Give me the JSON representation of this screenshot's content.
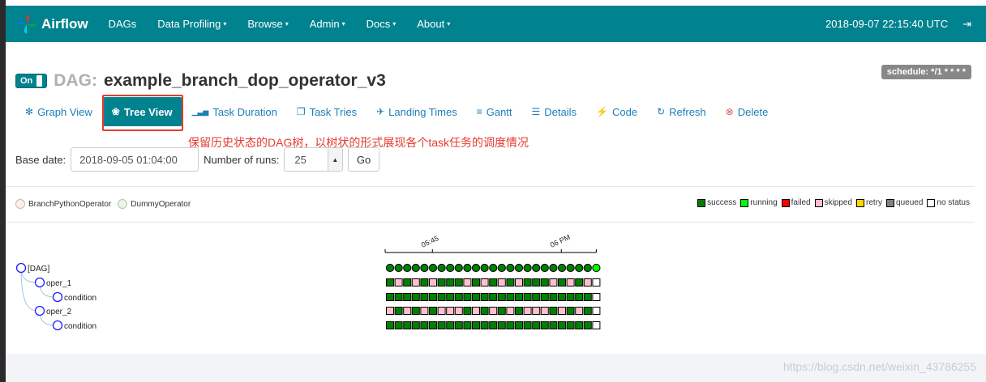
{
  "nav": {
    "brand": "Airflow",
    "links": [
      "DAGs",
      "Data Profiling",
      "Browse",
      "Admin",
      "Docs",
      "About"
    ],
    "dropdown_flags": [
      false,
      true,
      true,
      true,
      true,
      true
    ],
    "timestamp": "2018-09-07 22:15:40 UTC"
  },
  "dag": {
    "toggle_label": "On",
    "label": "DAG:",
    "name": "example_branch_dop_operator_v3",
    "schedule": "schedule: */1 * * * *"
  },
  "tabs": [
    {
      "label": "Graph View",
      "icon": "asterisk-icon"
    },
    {
      "label": "Tree View",
      "icon": "tree-icon",
      "active": true
    },
    {
      "label": "Task Duration",
      "icon": "bar-chart-icon"
    },
    {
      "label": "Task Tries",
      "icon": "files-icon"
    },
    {
      "label": "Landing Times",
      "icon": "plane-icon"
    },
    {
      "label": "Gantt",
      "icon": "align-left-icon"
    },
    {
      "label": "Details",
      "icon": "list-icon"
    },
    {
      "label": "Code",
      "icon": "flash-icon"
    },
    {
      "label": "Refresh",
      "icon": "refresh-icon"
    },
    {
      "label": "Delete",
      "icon": "remove-circle-icon"
    }
  ],
  "annotation": "保留历史状态的DAG树，以树状的形式展现各个task任务的调度情况",
  "form": {
    "base_date_label": "Base date:",
    "base_date_value": "2018-09-05 01:04:00",
    "runs_label": "Number of runs:",
    "runs_value": "25",
    "go_label": "Go"
  },
  "operators": [
    {
      "name": "BranchPythonOperator",
      "color": "#ffefeb"
    },
    {
      "name": "DummyOperator",
      "color": "#e8f7e4"
    }
  ],
  "legend": [
    {
      "label": "success",
      "color": "#008000"
    },
    {
      "label": "running",
      "color": "#00ff00"
    },
    {
      "label": "failed",
      "color": "#ff0000"
    },
    {
      "label": "skipped",
      "color": "#ffc0cb"
    },
    {
      "label": "retry",
      "color": "#ffd700"
    },
    {
      "label": "queued",
      "color": "#808080"
    },
    {
      "label": "no status",
      "color": "#ffffff"
    }
  ],
  "tree": {
    "time_ticks": [
      "05:45",
      "06 PM"
    ],
    "nodes": [
      "[DAG]",
      "oper_1",
      "condition",
      "oper_2",
      "condition"
    ],
    "run_states": [
      "success",
      "success",
      "success",
      "success",
      "success",
      "success",
      "success",
      "success",
      "success",
      "success",
      "success",
      "success",
      "success",
      "success",
      "success",
      "success",
      "success",
      "success",
      "success",
      "success",
      "success",
      "success",
      "success",
      "success",
      "running"
    ],
    "rows": [
      [
        "success",
        "skipped",
        "success",
        "skipped",
        "success",
        "skipped",
        "success",
        "success",
        "success",
        "skipped",
        "success",
        "skipped",
        "success",
        "skipped",
        "success",
        "skipped",
        "success",
        "success",
        "success",
        "skipped",
        "success",
        "skipped",
        "success",
        "skipped",
        "no status"
      ],
      [
        "success",
        "success",
        "success",
        "success",
        "success",
        "success",
        "success",
        "success",
        "success",
        "success",
        "success",
        "success",
        "success",
        "success",
        "success",
        "success",
        "success",
        "success",
        "success",
        "success",
        "success",
        "success",
        "success",
        "success",
        "no status"
      ],
      [
        "skipped",
        "success",
        "skipped",
        "success",
        "skipped",
        "success",
        "skipped",
        "skipped",
        "skipped",
        "success",
        "skipped",
        "success",
        "skipped",
        "success",
        "skipped",
        "success",
        "skipped",
        "skipped",
        "skipped",
        "success",
        "skipped",
        "success",
        "skipped",
        "success",
        "no status"
      ],
      [
        "success",
        "success",
        "success",
        "success",
        "success",
        "success",
        "success",
        "success",
        "success",
        "success",
        "success",
        "success",
        "success",
        "success",
        "success",
        "success",
        "success",
        "success",
        "success",
        "success",
        "success",
        "success",
        "success",
        "success",
        "no status"
      ]
    ]
  },
  "watermark": "https://blog.csdn.net/weixin_43786255"
}
